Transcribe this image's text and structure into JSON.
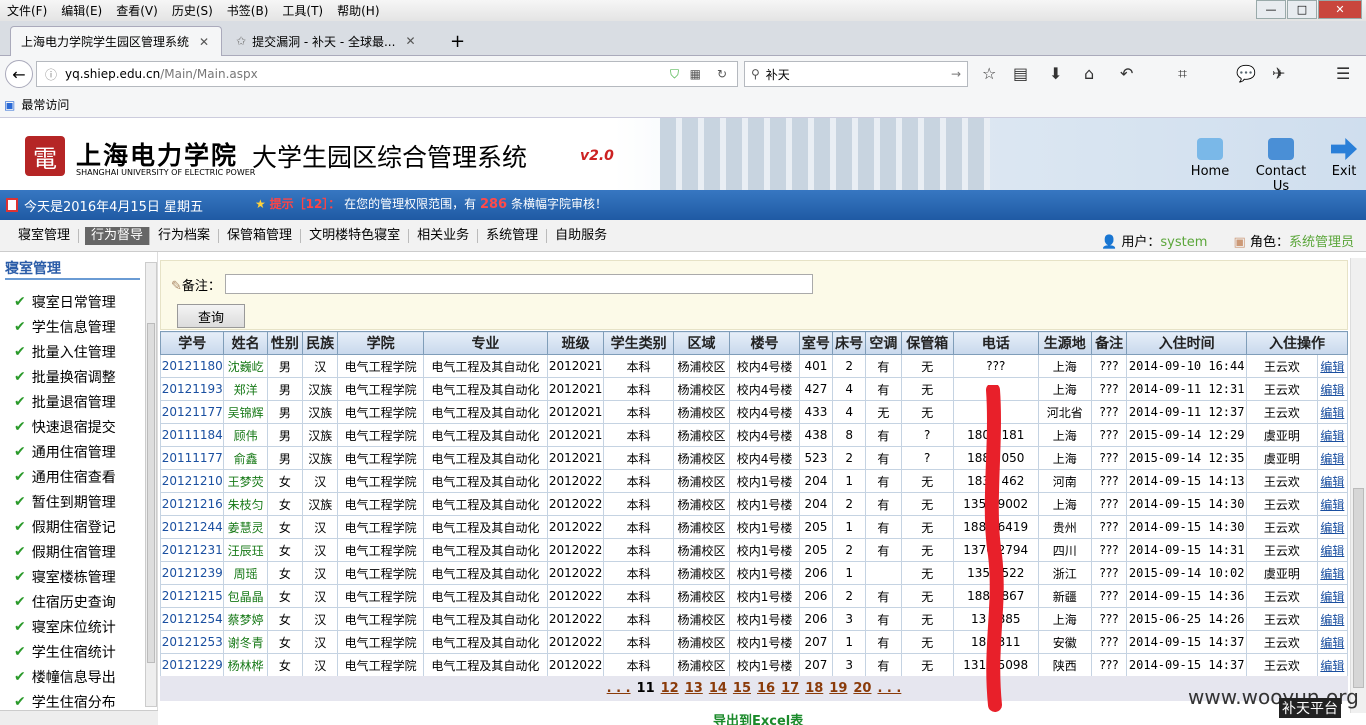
{
  "browser": {
    "menu": [
      "文件(F)",
      "编辑(E)",
      "查看(V)",
      "历史(S)",
      "书签(B)",
      "工具(T)",
      "帮助(H)"
    ],
    "window_controls": [
      "—",
      "□",
      "✕"
    ],
    "tabs": [
      {
        "label": "上海电力学院学生园区管理系统",
        "close": "✕"
      },
      {
        "label": "提交漏洞 - 补天 - 全球最...",
        "close": "✕"
      }
    ],
    "new_tab": "+",
    "url_host": "yq.shiep.edu.cn",
    "url_path": "/Main/Main.aspx",
    "search_value": "补天",
    "bookmark_label": "最常访问"
  },
  "header": {
    "school_cn": "上海电力学院",
    "school_en": "SHANGHAI UNIVERSITY OF ELECTRIC POWER",
    "system_title": "大学生园区综合管理系统",
    "version": "v2.0",
    "buttons": {
      "home": "Home",
      "contact": "Contact Us",
      "exit": "Exit"
    }
  },
  "status": {
    "date": "今天是2016年4月15日 星期五",
    "hint_label": "提示［12］：",
    "hint_text_before": "在您的管理权限范围，有",
    "hint_count": "286",
    "hint_text_after": "条横幅字院审核！"
  },
  "menu": [
    "寝室管理",
    "行为督导",
    "行为档案",
    "保管箱管理",
    "文明楼特色寝室",
    "相关业务",
    "系统管理",
    "自助服务"
  ],
  "user": {
    "user_label": "用户：",
    "user_value": "system",
    "role_label": "角色：",
    "role_value": "系统管理员"
  },
  "sidebar": {
    "title": "寝室管理",
    "items": [
      "寝室日常管理",
      "学生信息管理",
      "批量入住管理",
      "批量换宿调整",
      "批量退宿管理",
      "快速退宿提交",
      "通用住宿管理",
      "通用住宿查看",
      "暂住到期管理",
      "假期住宿登记",
      "假期住宿管理",
      "寝室楼栋管理",
      "住宿历史查询",
      "寝室床位统计",
      "学生住宿统计",
      "楼幢信息导出",
      "学生住宿分布"
    ]
  },
  "form": {
    "note_label": "备注：",
    "note_value": "",
    "query_button": "查询"
  },
  "table": {
    "headers": [
      "学号",
      "姓名",
      "性别",
      "民族",
      "学院",
      "专业",
      "班级",
      "学生类别",
      "区域",
      "楼号",
      "室号",
      "床号",
      "空调",
      "保管箱",
      "电话",
      "生源地",
      "备注",
      "入住时间",
      "入住操作",
      ""
    ],
    "rows": [
      [
        "20121180",
        "沈巍屹",
        "男",
        "汉",
        "电气工程学院",
        "电气工程及其自动化",
        "2012021",
        "本科",
        "杨浦校区",
        "校内4号楼",
        "401",
        "2",
        "有",
        "无",
        "???",
        "上海",
        "???",
        "2014-09-10 16:44",
        "王云欢",
        "编辑"
      ],
      [
        "20121193",
        "郑洋",
        "男",
        "汉族",
        "电气工程学院",
        "电气工程及其自动化",
        "2012021",
        "本科",
        "杨浦校区",
        "校内4号楼",
        "427",
        "4",
        "有",
        "无",
        "",
        "上海",
        "???",
        "2014-09-11 12:31",
        "王云欢",
        "编辑"
      ],
      [
        "20121177",
        "吴锦辉",
        "男",
        "汉族",
        "电气工程学院",
        "电气工程及其自动化",
        "2012021",
        "本科",
        "杨浦校区",
        "校内4号楼",
        "433",
        "4",
        "无",
        "无",
        "",
        "河北省",
        "???",
        "2014-09-11 12:37",
        "王云欢",
        "编辑"
      ],
      [
        "20111184",
        "顾伟",
        "男",
        "汉族",
        "电气工程学院",
        "电气工程及其自动化",
        "2012021",
        "本科",
        "杨浦校区",
        "校内4号楼",
        "438",
        "8",
        "有",
        "?",
        "1801  181",
        "上海",
        "???",
        "2015-09-14 12:29",
        "虞亚明",
        "编辑"
      ],
      [
        "20111177",
        "俞鑫",
        "男",
        "汉族",
        "电气工程学院",
        "电气工程及其自动化",
        "2012021",
        "本科",
        "杨浦校区",
        "校内4号楼",
        "523",
        "2",
        "有",
        "?",
        "1881  050",
        "上海",
        "???",
        "2015-09-14 12:35",
        "虞亚明",
        "编辑"
      ],
      [
        "20121210",
        "王梦荧",
        "女",
        "汉",
        "电气工程学院",
        "电气工程及其自动化",
        "2012022",
        "本科",
        "杨浦校区",
        "校内1号楼",
        "204",
        "1",
        "有",
        "无",
        "1832  462",
        "河南",
        "???",
        "2014-09-15 14:13",
        "王云欢",
        "编辑"
      ],
      [
        "20121216",
        "朱枝匀",
        "女",
        "汉族",
        "电气工程学院",
        "电气工程及其自动化",
        "2012022",
        "本科",
        "杨浦校区",
        "校内1号楼",
        "204",
        "2",
        "有",
        "无",
        "1356  9002",
        "上海",
        "???",
        "2014-09-15 14:30",
        "王云欢",
        "编辑"
      ],
      [
        "20121244",
        "姜慧灵",
        "女",
        "汉",
        "电气工程学院",
        "电气工程及其自动化",
        "2012022",
        "本科",
        "杨浦校区",
        "校内1号楼",
        "205",
        "1",
        "有",
        "无",
        "1881  6419",
        "贵州",
        "???",
        "2014-09-15 14:30",
        "王云欢",
        "编辑"
      ],
      [
        "20121231",
        "汪辰珏",
        "女",
        "汉",
        "电气工程学院",
        "电气工程及其自动化",
        "2012022",
        "本科",
        "杨浦校区",
        "校内1号楼",
        "205",
        "2",
        "有",
        "无",
        "1376  2794",
        "四川",
        "???",
        "2014-09-15 14:31",
        "王云欢",
        "编辑"
      ],
      [
        "20121239",
        "周瑶",
        "女",
        "汉",
        "电气工程学院",
        "电气工程及其自动化",
        "2012022",
        "本科",
        "杨浦校区",
        "校内1号楼",
        "206",
        "1",
        "",
        "无",
        "135  7522",
        "浙江",
        "???",
        "2015-09-14 10:02",
        "虞亚明",
        "编辑"
      ],
      [
        "20121215",
        "包晶晶",
        "女",
        "汉",
        "电气工程学院",
        "电气工程及其自动化",
        "2012022",
        "本科",
        "杨浦校区",
        "校内1号楼",
        "206",
        "2",
        "有",
        "无",
        "188  0867",
        "新疆",
        "???",
        "2014-09-15 14:36",
        "王云欢",
        "编辑"
      ],
      [
        "20121254",
        "蔡梦婷",
        "女",
        "汉",
        "电气工程学院",
        "电气工程及其自动化",
        "2012022",
        "本科",
        "杨浦校区",
        "校内1号楼",
        "206",
        "3",
        "有",
        "无",
        "13  0885",
        "上海",
        "???",
        "2015-06-25 14:26",
        "王云欢",
        "编辑"
      ],
      [
        "20121253",
        "谢冬青",
        "女",
        "汉",
        "电气工程学院",
        "电气工程及其自动化",
        "2012022",
        "本科",
        "杨浦校区",
        "校内1号楼",
        "207",
        "1",
        "有",
        "无",
        "18  1311",
        "安徽",
        "???",
        "2014-09-15 14:37",
        "王云欢",
        "编辑"
      ],
      [
        "20121229",
        "杨林桦",
        "女",
        "汉",
        "电气工程学院",
        "电气工程及其自动化",
        "2012022",
        "本科",
        "杨浦校区",
        "校内1号楼",
        "207",
        "3",
        "有",
        "无",
        "1312  5098",
        "陕西",
        "???",
        "2014-09-15 14:37",
        "王云欢",
        "编辑"
      ]
    ]
  },
  "pager": {
    "prev": ". . .",
    "pages": [
      "11",
      "12",
      "13",
      "14",
      "15",
      "16",
      "17",
      "18",
      "19",
      "20"
    ],
    "next": ". . .",
    "current": "11"
  },
  "export_label": "导出到Excel表",
  "watermark": {
    "site": "www.wooyun.org",
    "tag": "补天平台"
  },
  "colors": {
    "status_blue": "#2a66b4",
    "link_blue": "#1a4fa0",
    "name_green": "#187a18",
    "hint_red": "#ff4a4a",
    "export_green": "#1a8a2a"
  }
}
